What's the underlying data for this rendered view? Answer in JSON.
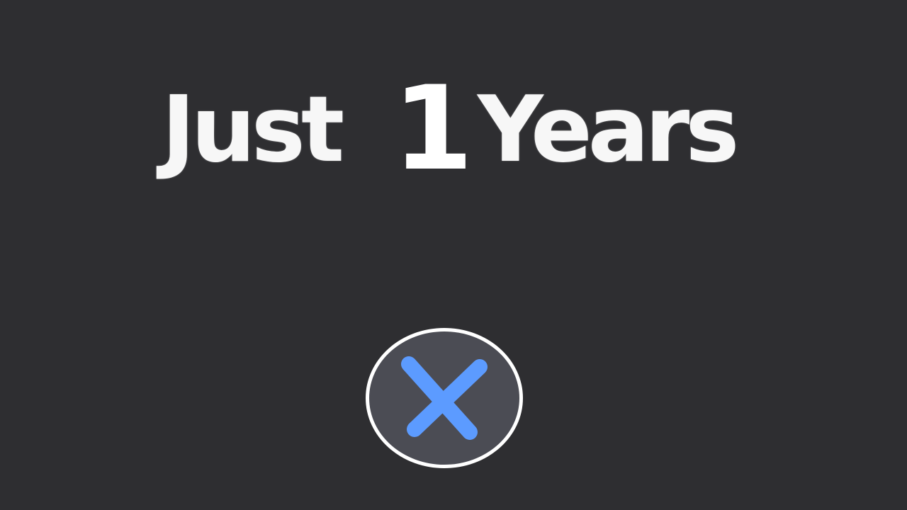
{
  "headline": {
    "prefix": "Just",
    "number": "1",
    "suffix": "Years"
  },
  "close_button": {
    "icon": "close-icon",
    "icon_color": "#5c9bff",
    "fill_color": "#4b4c54",
    "border_color": "#ffffff"
  },
  "colors": {
    "background": "#2e2e31",
    "text": "#f7f7f7"
  }
}
